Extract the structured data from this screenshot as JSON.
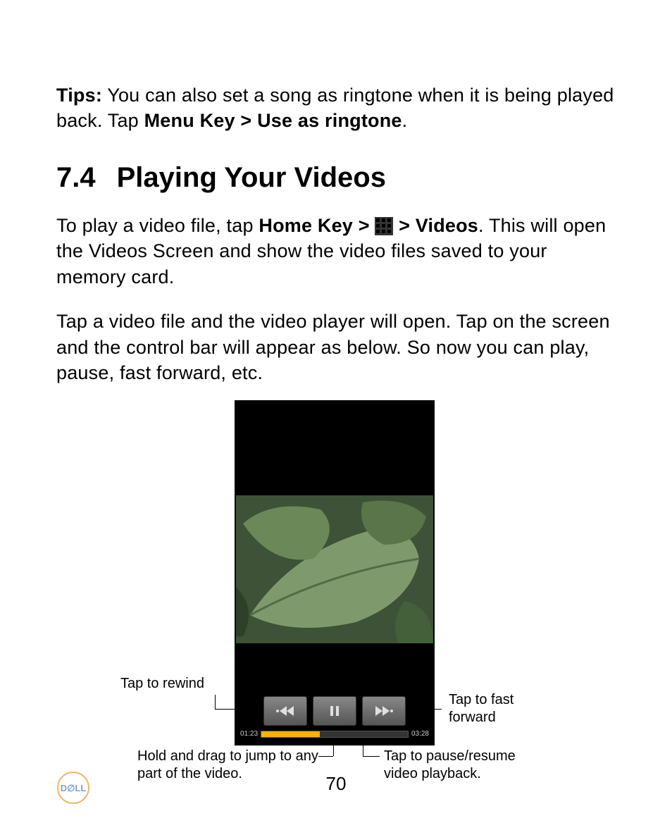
{
  "tips": {
    "label": "Tips:",
    "text1": " You can also set a song as ringtone when it is being played back. Tap ",
    "bold1": "Menu Key > Use as ringtone",
    "text2": "."
  },
  "heading": {
    "number": "7.4",
    "title": "Playing Your Videos"
  },
  "para1": {
    "t1": "To play a video file, tap ",
    "b1": "Home Key > ",
    "b2": " > Videos",
    "t2": ". This will open the Videos Screen and show the video files saved to your memory card."
  },
  "para2": "Tap a video file and the video player will open. Tap on the screen and the control bar will appear as below. So now you can play, pause, fast forward, etc.",
  "player": {
    "elapsed": "01:23",
    "total": "03:28",
    "progress_percent": 40
  },
  "callouts": {
    "rewind": "Tap to rewind",
    "fastforward": "Tap to fast forward",
    "pause": "Tap to pause/resume video playback.",
    "drag": "Hold and drag to jump to any part of the video."
  },
  "page_number": "70"
}
